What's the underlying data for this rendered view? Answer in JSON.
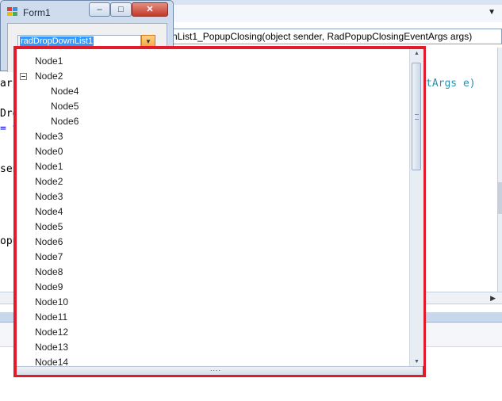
{
  "form": {
    "title": "Form1",
    "minimize_glyph": "–",
    "maximize_glyph": "□",
    "close_glyph": "✕"
  },
  "dropdown": {
    "value": "radDropDownList1",
    "arrow_glyph": "▼"
  },
  "editor": {
    "method_combo": "nList1_PopupClosing(object sender, RadPopupClosingEventArgs args)",
    "top_arrow": "▼",
    "scroll_arrow": "▶",
    "fragments": [
      {
        "id": "frag1",
        "text": "ar"
      },
      {
        "id": "frag2",
        "text": "tArgs e)"
      },
      {
        "id": "frag3",
        "text": "Dro"
      },
      {
        "id": "frag4",
        "text": "= t"
      },
      {
        "id": "frag5",
        "text": "sen"
      },
      {
        "id": "frag6",
        "text": "opu"
      }
    ]
  },
  "popup": {
    "nodes": [
      {
        "label": "Node1",
        "level": 0,
        "expander": false
      },
      {
        "label": "Node2",
        "level": 0,
        "expander": true
      },
      {
        "label": "Node4",
        "level": 1,
        "expander": false
      },
      {
        "label": "Node5",
        "level": 1,
        "expander": false
      },
      {
        "label": "Node6",
        "level": 1,
        "expander": false
      },
      {
        "label": "Node3",
        "level": 0,
        "expander": false
      },
      {
        "label": "Node0",
        "level": 0,
        "expander": false
      },
      {
        "label": "Node1",
        "level": 0,
        "expander": false
      },
      {
        "label": "Node2",
        "level": 0,
        "expander": false
      },
      {
        "label": "Node3",
        "level": 0,
        "expander": false
      },
      {
        "label": "Node4",
        "level": 0,
        "expander": false
      },
      {
        "label": "Node5",
        "level": 0,
        "expander": false
      },
      {
        "label": "Node6",
        "level": 0,
        "expander": false
      },
      {
        "label": "Node7",
        "level": 0,
        "expander": false
      },
      {
        "label": "Node8",
        "level": 0,
        "expander": false
      },
      {
        "label": "Node9",
        "level": 0,
        "expander": false
      },
      {
        "label": "Node10",
        "level": 0,
        "expander": false
      },
      {
        "label": "Node11",
        "level": 0,
        "expander": false
      },
      {
        "label": "Node12",
        "level": 0,
        "expander": false
      },
      {
        "label": "Node13",
        "level": 0,
        "expander": false
      },
      {
        "label": "Node14",
        "level": 0,
        "expander": false
      }
    ],
    "scroll_up_glyph": "▲",
    "scroll_down_glyph": "▼",
    "resize_grip": "....",
    "highlight_color": "#e21b2a"
  }
}
